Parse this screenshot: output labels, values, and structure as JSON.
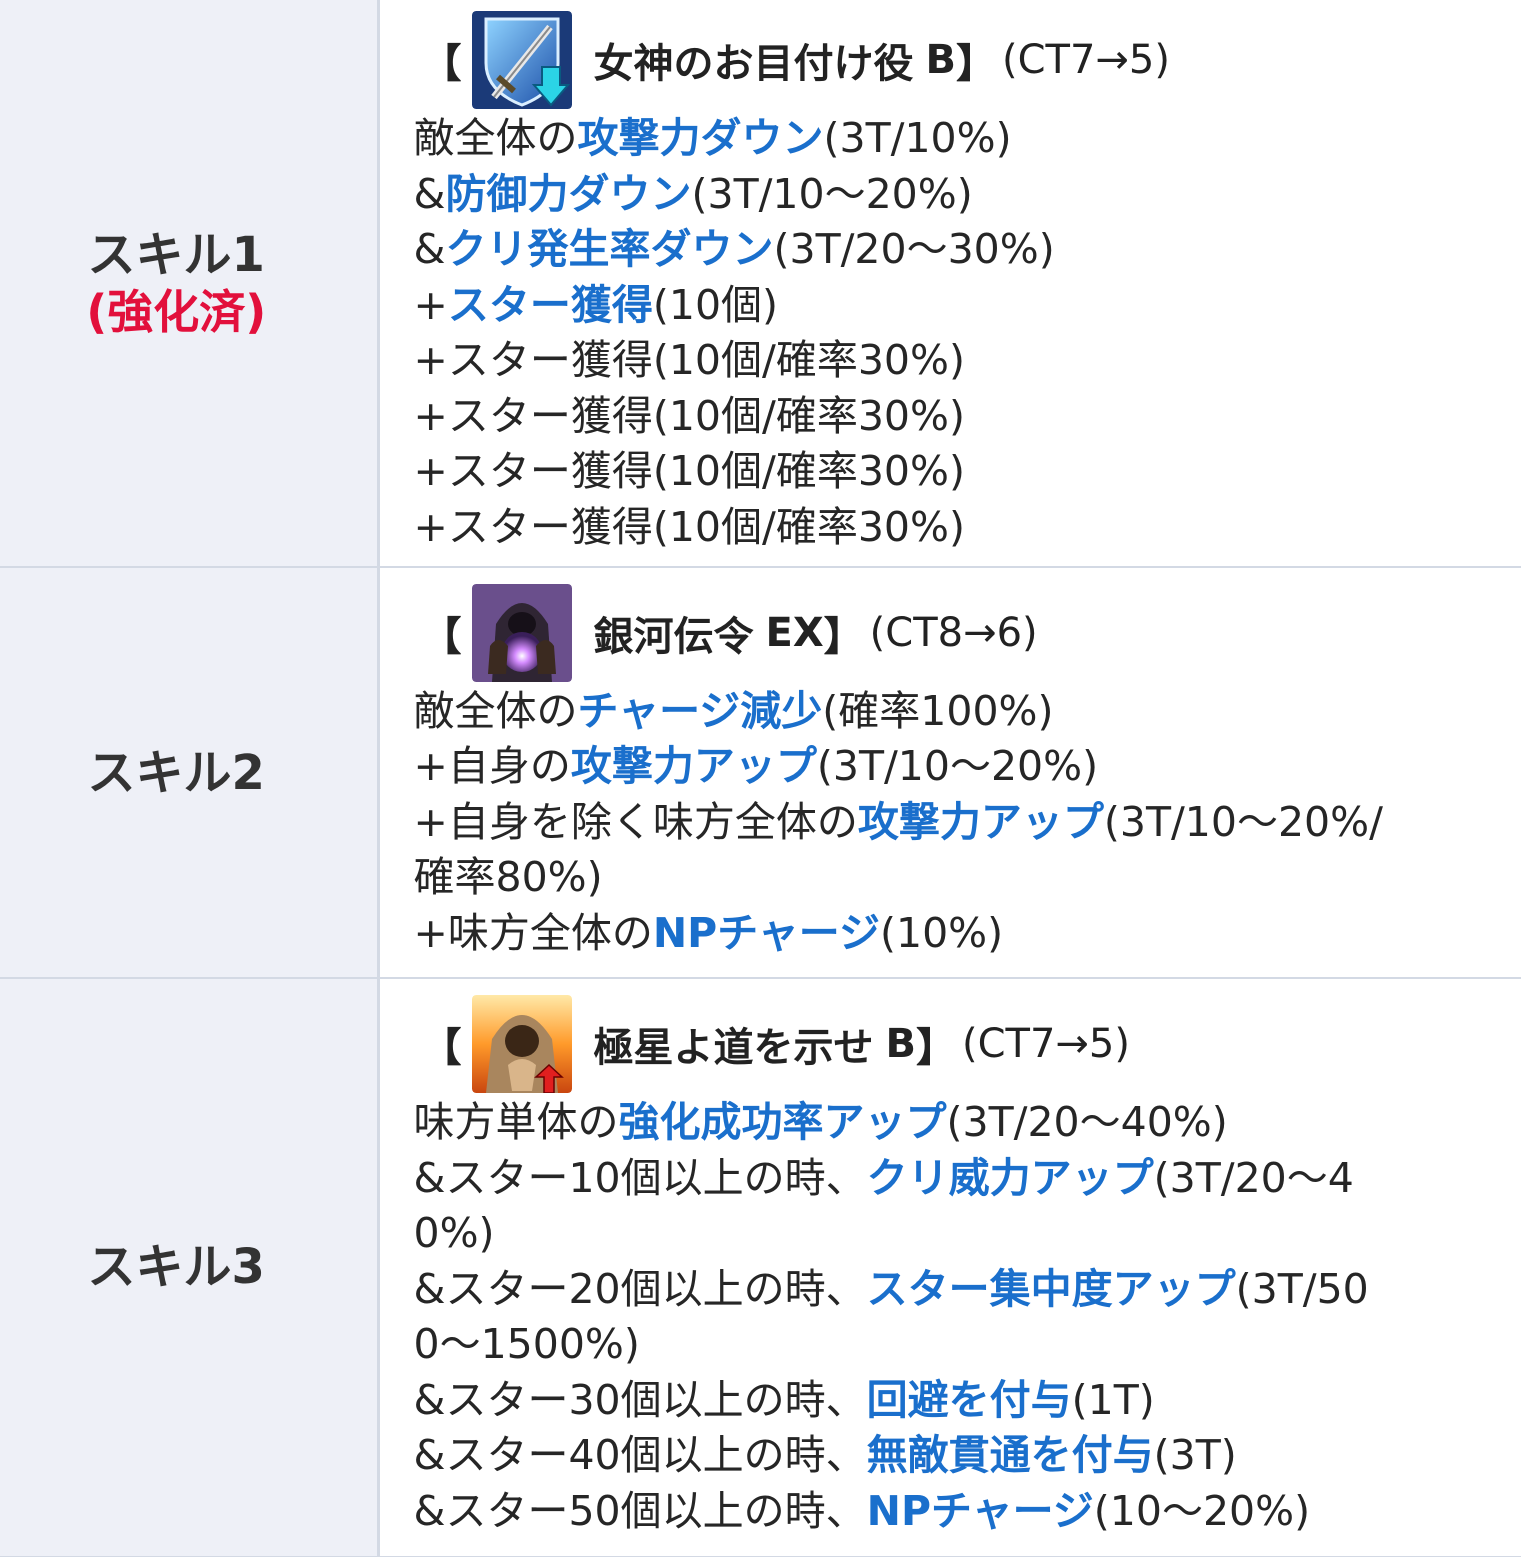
{
  "skills": [
    {
      "label": "スキル1",
      "note": "(強化済)",
      "icon": "sword-shield-down-icon",
      "name": "女神のお目付け役",
      "rank": "B",
      "cooldown": "(CT7→5)",
      "lines": [
        [
          {
            "t": "敵全体の"
          },
          {
            "t": "攻撃力ダウン",
            "h": true
          },
          {
            "t": "(3T/10%)"
          }
        ],
        [
          {
            "t": "&"
          },
          {
            "t": "防御力ダウン",
            "h": true
          },
          {
            "t": "(3T/10〜20%)"
          }
        ],
        [
          {
            "t": "&"
          },
          {
            "t": "クリ発生率ダウン",
            "h": true
          },
          {
            "t": "(3T/20〜30%)"
          }
        ],
        [
          {
            "t": "+"
          },
          {
            "t": "スター獲得",
            "h": true
          },
          {
            "t": "(10個)"
          }
        ],
        [
          {
            "t": "+スター獲得(10個/確率30%)"
          }
        ],
        [
          {
            "t": "+スター獲得(10個/確率30%)"
          }
        ],
        [
          {
            "t": "+スター獲得(10個/確率30%)"
          }
        ],
        [
          {
            "t": "+スター獲得(10個/確率30%)"
          }
        ]
      ]
    },
    {
      "label": "スキル2",
      "note": "",
      "icon": "hooded-figure-orb-icon",
      "name": "銀河伝令",
      "rank": "EX",
      "cooldown": "(CT8→6)",
      "lines": [
        [
          {
            "t": "敵全体の"
          },
          {
            "t": "チャージ減少",
            "h": true
          },
          {
            "t": "(確率100%)"
          }
        ],
        [
          {
            "t": "+自身の"
          },
          {
            "t": "攻撃力アップ",
            "h": true
          },
          {
            "t": "(3T/10〜20%)"
          }
        ],
        [
          {
            "t": "+自身を除く味方全体の"
          },
          {
            "t": "攻撃力アップ",
            "h": true
          },
          {
            "t": "(3T/10〜20%/"
          }
        ],
        [
          {
            "t": "確率80%)"
          }
        ],
        [
          {
            "t": "+味方全体の"
          },
          {
            "t": "NPチャージ",
            "h": true
          },
          {
            "t": "(10%)"
          }
        ]
      ]
    },
    {
      "label": "スキル3",
      "note": "",
      "icon": "hooded-figure-up-icon",
      "name": "極星よ道を示せ",
      "rank": "B",
      "cooldown": "(CT7→5)",
      "lines": [
        [
          {
            "t": "味方単体の"
          },
          {
            "t": "強化成功率アップ",
            "h": true
          },
          {
            "t": "(3T/20〜40%)"
          }
        ],
        [
          {
            "t": "&スター10個以上の時、"
          },
          {
            "t": "クリ威力アップ",
            "h": true
          },
          {
            "t": "(3T/20〜4"
          }
        ],
        [
          {
            "t": "0%)"
          }
        ],
        [
          {
            "t": "&スター20個以上の時、"
          },
          {
            "t": "スター集中度アップ",
            "h": true
          },
          {
            "t": "(3T/50"
          }
        ],
        [
          {
            "t": "0〜1500%)"
          }
        ],
        [
          {
            "t": "&スター30個以上の時、"
          },
          {
            "t": "回避を付与",
            "h": true
          },
          {
            "t": "(1T)"
          }
        ],
        [
          {
            "t": "&スター40個以上の時、"
          },
          {
            "t": "無敵貫通を付与",
            "h": true
          },
          {
            "t": "(3T)"
          }
        ],
        [
          {
            "t": "&スター50個以上の時、"
          },
          {
            "t": "NPチャージ",
            "h": true
          },
          {
            "t": "(10〜20%)"
          }
        ]
      ]
    }
  ],
  "colors": {
    "highlight": "#1a6fcc",
    "enhanced_note": "#e2103c",
    "label_bg": "#eef0f7",
    "border": "#d3d9e4"
  }
}
